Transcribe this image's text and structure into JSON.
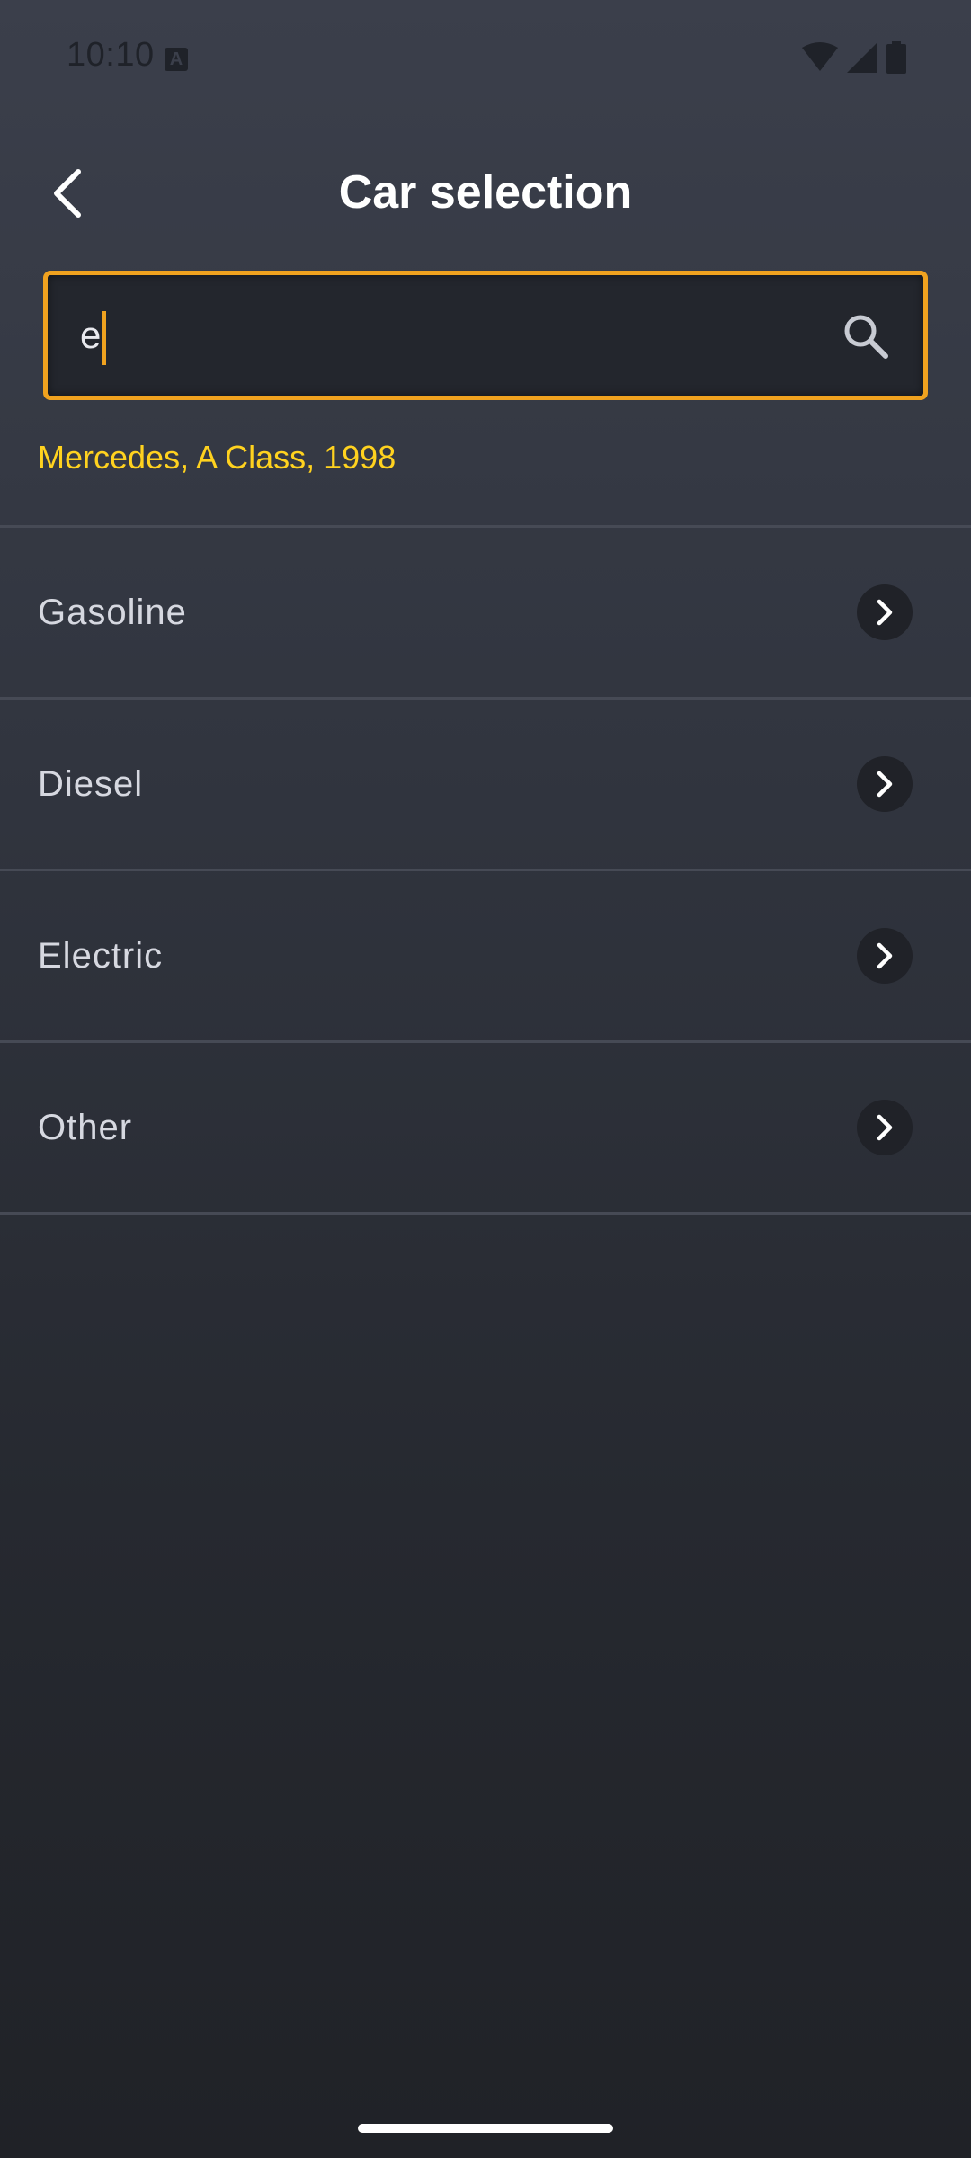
{
  "status_bar": {
    "time": "10:10",
    "notification_icon": "a-icon",
    "icons": [
      "wifi-icon",
      "signal-icon",
      "battery-icon"
    ]
  },
  "header": {
    "title": "Car selection",
    "back_icon": "chevron-left-icon"
  },
  "search": {
    "value": "e",
    "placeholder": "",
    "icon": "search-icon",
    "border_color": "#f0a21f"
  },
  "selected_car": {
    "text": "Mercedes, A Class, 1998",
    "color": "#ffd21f"
  },
  "fuel_types": [
    {
      "label": "Gasoline"
    },
    {
      "label": "Diesel"
    },
    {
      "label": "Electric"
    },
    {
      "label": "Other"
    }
  ],
  "item_icon": "chevron-right-icon"
}
